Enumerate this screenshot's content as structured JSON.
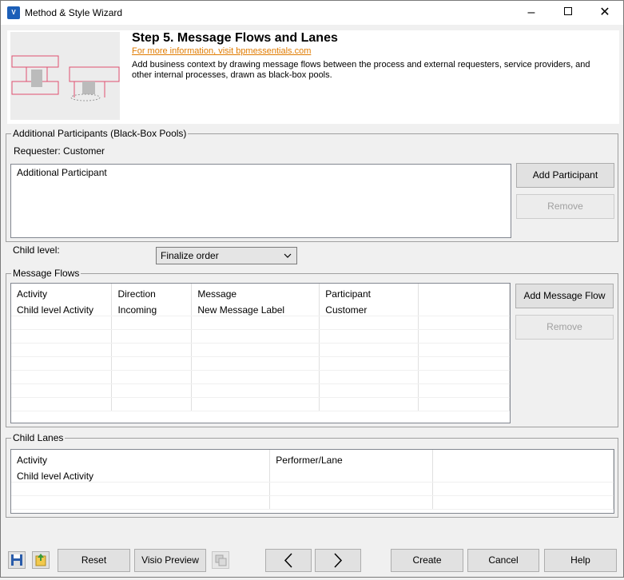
{
  "window": {
    "title": "Method & Style Wizard",
    "app_icon": "visio-app-icon",
    "controls": {
      "minimize": "–",
      "maximize": "□",
      "close": "✕"
    }
  },
  "header": {
    "step_title": "Step 5. Message Flows and Lanes",
    "link_text": "For more information, visit bpmessentials.com",
    "description": "Add business context by drawing message flows between the process and external requesters, service providers, and other internal processes, drawn as black-box pools.",
    "link_color": "#e07b00"
  },
  "participants": {
    "group_label": "Additional Participants (Black-Box Pools)",
    "requester": "Requester: Customer",
    "list_items": [
      "Additional Participant"
    ],
    "add_button": "Add Participant",
    "remove_button": "Remove"
  },
  "child_level": {
    "label": "Child level:",
    "selected": "Finalize order"
  },
  "message_flows": {
    "group_label": "Message Flows",
    "columns": [
      "Activity",
      "Direction",
      "Message",
      "Participant",
      ""
    ],
    "rows": [
      [
        "Child level Activity",
        "Incoming",
        "New Message Label",
        "Customer",
        ""
      ]
    ],
    "add_button": "Add Message Flow",
    "remove_button": "Remove"
  },
  "child_lanes": {
    "group_label": "Child Lanes",
    "columns": [
      "Activity",
      "Performer/Lane",
      ""
    ],
    "rows": [
      [
        "Child level Activity",
        "",
        ""
      ]
    ]
  },
  "footer": {
    "save_icon": "save-icon",
    "export_icon": "export-icon",
    "reset": "Reset",
    "visio_preview": "Visio Preview",
    "copy_icon": "copy-icon",
    "back": "‹",
    "forward": "›",
    "create": "Create",
    "cancel": "Cancel",
    "help": "Help"
  }
}
